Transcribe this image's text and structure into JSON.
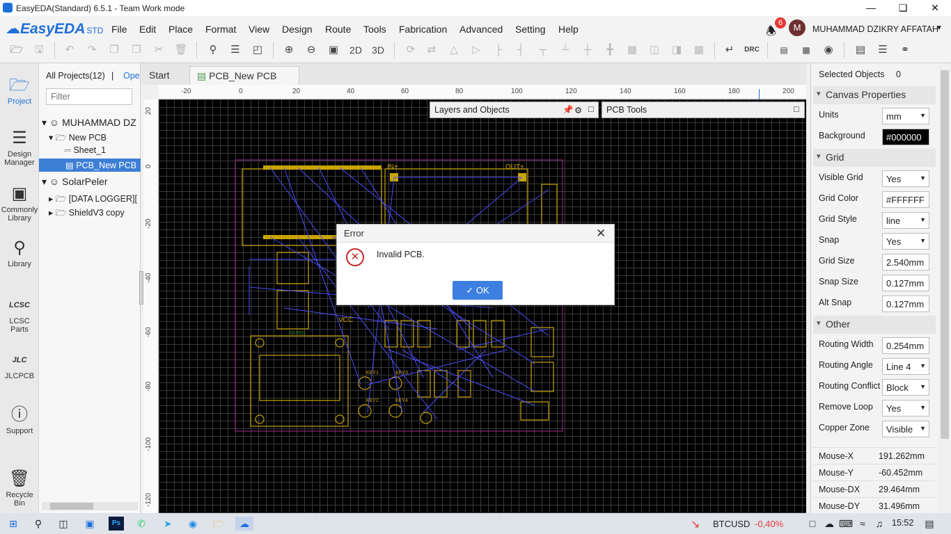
{
  "window": {
    "title": "EasyEDA(Standard) 6.5.1 - Team Work mode"
  },
  "brand": {
    "name": "EasyEDA",
    "suffix": "STD"
  },
  "menu": [
    "File",
    "Edit",
    "Place",
    "Format",
    "View",
    "Design",
    "Route",
    "Tools",
    "Fabrication",
    "Advanced",
    "Setting",
    "Help"
  ],
  "user": {
    "notifications": "6",
    "avatar_letter": "M",
    "name": "MUHAMMAD DZIKRY AFFATAH"
  },
  "toolbar": {
    "view_2d": "2D",
    "view_3d": "3D",
    "drc": "DRC"
  },
  "leftnav": [
    {
      "label": "Project",
      "icon": "folder-icon"
    },
    {
      "label": "Design Manager",
      "icon": "list-icon"
    },
    {
      "label": "Commonly Library",
      "icon": "chip-icon"
    },
    {
      "label": "Library",
      "icon": "search-icon"
    },
    {
      "label": "LCSC Parts",
      "icon": "lcsc-icon"
    },
    {
      "label": "JLCPCB",
      "icon": "jlc-icon"
    },
    {
      "label": "Support",
      "icon": "help-icon"
    },
    {
      "label": "Recycle Bin",
      "icon": "trash-icon"
    }
  ],
  "project": {
    "all_projects": "All Projects(12)",
    "separator": "|",
    "open_link": "Ope",
    "filter_placeholder": "Filter",
    "tree": {
      "owner": "MUHAMMAD DZ",
      "new_pcb_folder": "New PCB",
      "sheet": "Sheet_1",
      "pcb": "PCB_New PCB",
      "team": "SolarPeler",
      "folder1": "[DATA LOGGER][",
      "folder2": "ShieldV3 copy"
    }
  },
  "tabs": [
    "Start",
    "PCB_New PCB"
  ],
  "ruler": {
    "top": [
      "-20",
      "0",
      "20",
      "40",
      "60",
      "80",
      "100",
      "120",
      "140",
      "160",
      "180",
      "200"
    ],
    "left": [
      "20",
      "0",
      "-20",
      "-40",
      "-60",
      "-80",
      "-100",
      "-120"
    ]
  },
  "panels": {
    "layers": "Layers and Objects",
    "tools": "PCB Tools"
  },
  "pcb_labels": {
    "in": "IN+",
    "out": "OUT+",
    "key1": "KEY1",
    "key2": "KEY2",
    "key3": "KEY3",
    "key4": "KEY4",
    "vcc": "VCC",
    "oled": "OLED1"
  },
  "right": {
    "selected_label": "Selected Objects",
    "selected_count": "0",
    "canvas_title": "Canvas Properties",
    "units_label": "Units",
    "units": "mm",
    "background_label": "Background",
    "background": "#000000",
    "grid_title": "Grid",
    "visible_grid_label": "Visible Grid",
    "visible_grid": "Yes",
    "grid_color_label": "Grid Color",
    "grid_color": "#FFFFFF",
    "grid_style_label": "Grid Style",
    "grid_style": "line",
    "snap_label": "Snap",
    "snap": "Yes",
    "grid_size_label": "Grid Size",
    "grid_size": "2.540mm",
    "snap_size_label": "Snap Size",
    "snap_size": "0.127mm",
    "alt_snap_label": "Alt Snap",
    "alt_snap": "0.127mm",
    "other_title": "Other",
    "routing_width_label": "Routing Width",
    "routing_width": "0.254mm",
    "routing_angle_label": "Routing Angle",
    "routing_angle": "Line 4",
    "routing_conflict_label": "Routing Conflict",
    "routing_conflict": "Block",
    "remove_loop_label": "Remove Loop",
    "remove_loop": "Yes",
    "copper_zone_label": "Copper Zone",
    "copper_zone": "Visible"
  },
  "status": {
    "mouse_x_label": "Mouse-X",
    "mouse_x": "191.262mm",
    "mouse_y_label": "Mouse-Y",
    "mouse_y": "-60.452mm",
    "mouse_dx_label": "Mouse-DX",
    "mouse_dx": "29.464mm",
    "mouse_dy_label": "Mouse-DY",
    "mouse_dy": "31.496mm"
  },
  "dialog": {
    "title": "Error",
    "message": "Invalid PCB.",
    "ok": "OK"
  },
  "taskbar": {
    "ticker": "BTCUSD",
    "change": "-0,40%",
    "time": "15:52",
    "ps": "Ps"
  },
  "colors": {
    "accent": "#1e6fd9",
    "canvas": "#000000",
    "board_outline": "#8a2a7a",
    "silk": "#c8a400",
    "ratline": "#4d4dff",
    "error": "#c62828",
    "ticker_down": "#e53935"
  }
}
